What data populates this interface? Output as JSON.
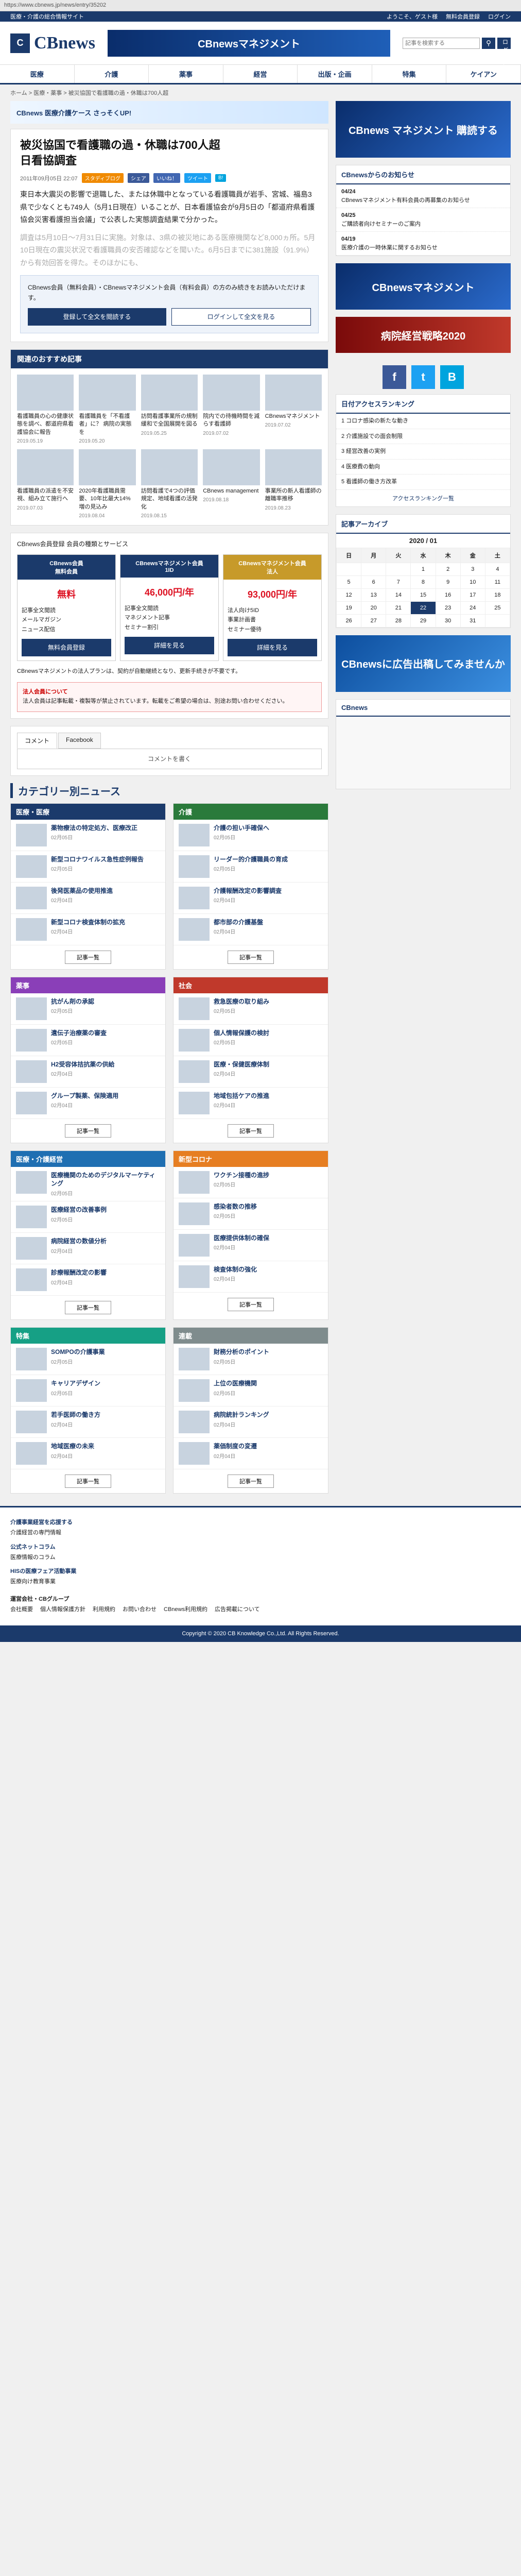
{
  "url": "https://www.cbnews.jp/news/entry/35202",
  "topbar": {
    "left": "医療・介護の総合情報サイト",
    "links": [
      "ようこそ、ゲスト様",
      "無料会員登録",
      "ログイン"
    ]
  },
  "brand": {
    "name": "CBnews",
    "banner": "CBnewsマネジメント"
  },
  "search": {
    "placeholder": "記事を検索する",
    "login": "ログイン"
  },
  "gnav": [
    "医療",
    "介護",
    "薬事",
    "経営",
    "出版・企画",
    "特集",
    "ケイアン"
  ],
  "breadcrumb": "ホーム > 医療・薬事 > 被災協国で看護職の過・休職は700人超",
  "adbar": {
    "text": "CBnews 医療介護ケース さっそくUP!",
    "cta": "詳しく"
  },
  "article": {
    "title": "被災協国で看護職の過・休職は700人超\n日看協調査",
    "date": "2011年09月05日 22:07",
    "tags": [
      "スタディブログ",
      "シェア"
    ],
    "tag_colors": [
      "#f08a00",
      "#3b5998"
    ],
    "share": [
      "いいね！",
      "ツイート",
      "B!"
    ],
    "paragraphs": [
      "東日本大震災の影響で退職した、または休職中となっている看護職員が岩手、宮城、福島3県で少なくとも749人（5月1日現在）いることが、日本看護協会が9月5日の「都道府県看護協会災害看護担当会議」で公表した実態調査結果で分かった。",
      "調査は5月10日～7月31日に実施。対象は、3県の被災地にある医療機関など8,000ヵ所。5月10日現在の震災状況で看護職員の安否確認などを聞いた。6月5日までに381施設（91.9%）から有効回答を得た。そのほかにも、"
    ],
    "lock_notice": "CBnews会員（無料会員）・CBnewsマネジメント会員（有料会員）の方のみ続きをお読みいただけます。",
    "btn_register": "登録して全文を閲読する",
    "btn_login": "ログインして全文を見る"
  },
  "recommend": {
    "title": "関連のおすすめ記事",
    "items": [
      {
        "text": "看護職員の心の健康状態を調べ、都道府県看護協会に報告",
        "date": "2019.05.19"
      },
      {
        "text": "看護職員を「不看護者」に？ 病院の実態を",
        "date": "2019.05.20"
      },
      {
        "text": "訪問看護事業所の規制緩和で全国展開を図る",
        "date": "2019.05.25"
      },
      {
        "text": "院内での待機時間を減らす看護師",
        "date": "2019.07.02"
      },
      {
        "text": "CBnewsマネジメント",
        "date": "2019.07.02"
      },
      {
        "text": "看護職員の派遣を不安視、組み立て施行へ",
        "date": "2019.07.03"
      },
      {
        "text": "2020年看護職員需要、10年比最大14%増の見込み",
        "date": "2019.08.04"
      },
      {
        "text": "訪問看護で4つの評価規定、地域看護の活発化",
        "date": "2019.08.15"
      },
      {
        "text": "CBnews management",
        "date": "2019.08.18"
      },
      {
        "text": "事業所の新人看護師の離職率推移",
        "date": "2019.08.23"
      }
    ]
  },
  "plans": {
    "intro": "CBnews会員登録 会員の種類とサービス",
    "columns": [
      {
        "name": "CBnews会員",
        "sub": "無料会員",
        "price": "無料",
        "feats": [
          "記事全文閲読",
          "メールマガジン",
          "ニュース配信"
        ],
        "cta": "無料会員登録"
      },
      {
        "name": "CBnewsマネジメント会員",
        "sub": "1ID",
        "price": "46,000円/年",
        "feats": [
          "記事全文閲読",
          "マネジメント記事",
          "セミナー割引"
        ],
        "cta": "詳細を見る"
      },
      {
        "name": "CBnewsマネジメント会員",
        "sub": "法人",
        "price": "93,000円/年",
        "feats": [
          "法人向け5ID",
          "事業計画書",
          "セミナー優待"
        ],
        "cta": "詳細を見る"
      }
    ],
    "note": "CBnewsマネジメントの法人プランは、契約が自動継続となり、更新手続きが不要です。",
    "warn_title": "法人会員について",
    "warn": "法人会員は記事転載・複製等が禁止されています。転載をご希望の場合は、別途お問い合わせください。"
  },
  "comments": {
    "tabs": [
      "コメント",
      "Facebook"
    ],
    "placeholder": "コメントを書く"
  },
  "categories": {
    "title": "カテゴリー別ニュース",
    "blocks": [
      {
        "name": "医療・医療",
        "color": "#1b3a6b",
        "items": [
          [
            "薬物療法の特定処方、医療改正",
            "02月05日"
          ],
          [
            "新型コロナワイルス急性症例報告",
            "02月05日"
          ],
          [
            "後発医薬品の使用推進",
            "02月04日"
          ],
          [
            "新型コロナ検査体制の拡充",
            "02月04日"
          ]
        ]
      },
      {
        "name": "介護",
        "color": "#2a7a3b",
        "items": [
          [
            "介護の担い手確保へ",
            "02月05日"
          ],
          [
            "リーダー的介護職員の育成",
            "02月05日"
          ],
          [
            "介護報酬改定の影響調査",
            "02月04日"
          ],
          [
            "都市部の介護基盤",
            "02月04日"
          ]
        ]
      },
      {
        "name": "薬事",
        "color": "#8a3fb8",
        "items": [
          [
            "抗がん剤の承認",
            "02月05日"
          ],
          [
            "遺伝子治療薬の審査",
            "02月05日"
          ],
          [
            "H2受容体拮抗薬の供給",
            "02月04日"
          ],
          [
            "グループ製薬、保険適用",
            "02月04日"
          ]
        ]
      },
      {
        "name": "社会",
        "color": "#c0392b",
        "items": [
          [
            "救急医療の取り組み",
            "02月05日"
          ],
          [
            "個人情報保護の検討",
            "02月05日"
          ],
          [
            "医療・保健医療体制",
            "02月04日"
          ],
          [
            "地域包括ケアの推進",
            "02月04日"
          ]
        ]
      },
      {
        "name": "医療・介護経営",
        "color": "#1f6fb2",
        "items": [
          [
            "医療機関のためのデジタルマーケティング",
            "02月05日"
          ],
          [
            "医療経営の改善事例",
            "02月05日"
          ],
          [
            "病院経営の数値分析",
            "02月04日"
          ],
          [
            "診療報酬改定の影響",
            "02月04日"
          ]
        ]
      },
      {
        "name": "新型コロナ",
        "color": "#e67e22",
        "items": [
          [
            "ワクチン接種の進捗",
            "02月05日"
          ],
          [
            "感染者数の推移",
            "02月05日"
          ],
          [
            "医療提供体制の確保",
            "02月04日"
          ],
          [
            "検査体制の強化",
            "02月04日"
          ]
        ]
      },
      {
        "name": "特集",
        "color": "#16a085",
        "items": [
          [
            "SOMPOの介護事業",
            "02月05日"
          ],
          [
            "キャリアデザイン",
            "02月05日"
          ],
          [
            "若手医師の働き方",
            "02月04日"
          ],
          [
            "地域医療の未来",
            "02月04日"
          ]
        ]
      },
      {
        "name": "連載",
        "color": "#7f8c8d",
        "items": [
          [
            "財務分析のポイント",
            "02月05日"
          ],
          [
            "上位の医療機関",
            "02月05日"
          ],
          [
            "病院統計ランキング",
            "02月04日"
          ],
          [
            "薬価制度の変遷",
            "02月04日"
          ]
        ]
      }
    ],
    "more": "記事一覧"
  },
  "side": {
    "ad1": "CBnews マネジメント 購読する",
    "news_title": "CBnewsからのお知らせ",
    "news": [
      [
        "04/24",
        "CBnewsマネジメント有料会員の再募集のお知らせ"
      ],
      [
        "04/25",
        "ご購読者向けセミナーのご案内"
      ],
      [
        "04/19",
        "医療介護の一時休業に関するお知らせ"
      ]
    ],
    "ad2": "CBnewsマネジメント",
    "ad3": "病院経営戦略2020",
    "ranking_title": "日付アクセスランキング",
    "ranking": [
      "1 コロナ感染の新たな動き",
      "2 介護施設での面会制限",
      "3 経営改善の実例",
      "4 医療費の動向",
      "5 看護師の働き方改革"
    ],
    "ranking_more": "アクセスランキング一覧",
    "archive_title": "記事アーカイブ",
    "archive_month": "2020 / 01",
    "week": [
      "日",
      "月",
      "火",
      "水",
      "木",
      "金",
      "土"
    ],
    "ad4": "CBnewsに広告出稿してみませんか",
    "twitter": "CBnews"
  },
  "footer": {
    "groups": [
      {
        "h": "介護事業経営を応援する",
        "t": "介護経営の専門情報"
      },
      {
        "h": "公式ネットコラム",
        "t": "医療情報のコラム"
      },
      {
        "h": "HISの医療フェア活動事業",
        "t": "医療向け教育事業"
      }
    ],
    "company": "運営会社・CBグループ",
    "links": [
      "会社概要",
      "個人情報保護方針",
      "利用規約",
      "お問い合わせ",
      "CBnews利用規約",
      "広告掲載について"
    ],
    "copyright": "Copyright © 2020 CB Knowledge Co.,Ltd. All Rights Reserved."
  }
}
